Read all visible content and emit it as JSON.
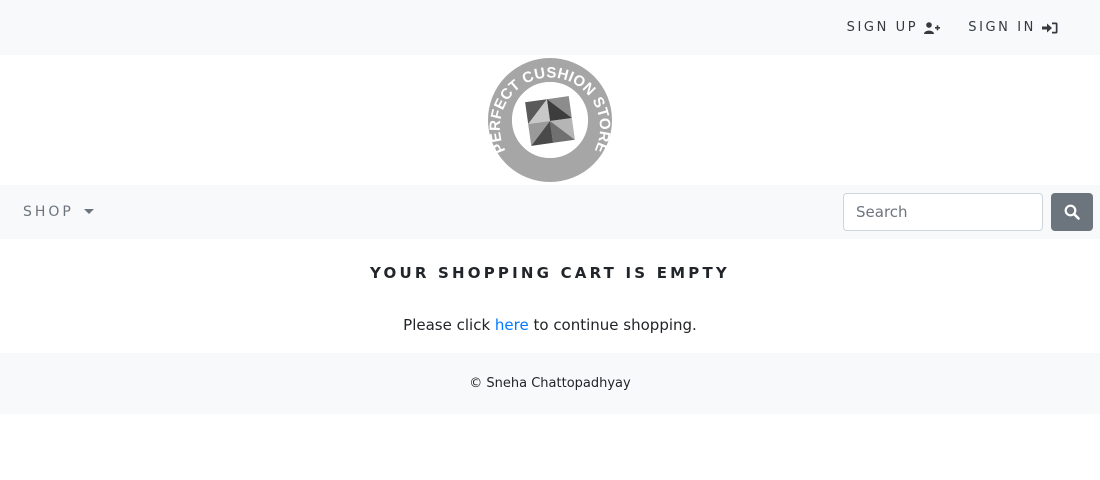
{
  "topbar": {
    "signup_label": "SIGN UP",
    "signup_icon": "user-plus-icon",
    "signin_label": "SIGN IN",
    "signin_icon": "sign-in-icon"
  },
  "logo": {
    "text": "PERFECT CUSHION STORE",
    "ring_color": "#a6a6a6"
  },
  "nav": {
    "shop_label": "SHOP",
    "search_placeholder": "Search",
    "search_value": "",
    "search_button_color": "#6c757d"
  },
  "cart": {
    "heading": "YOUR SHOPPING CART IS EMPTY",
    "text_before": "Please click ",
    "link_text": "here",
    "text_after": " to continue shopping.",
    "link_color": "#007bff"
  },
  "footer": {
    "text": "© Sneha Chattopadhyay"
  }
}
